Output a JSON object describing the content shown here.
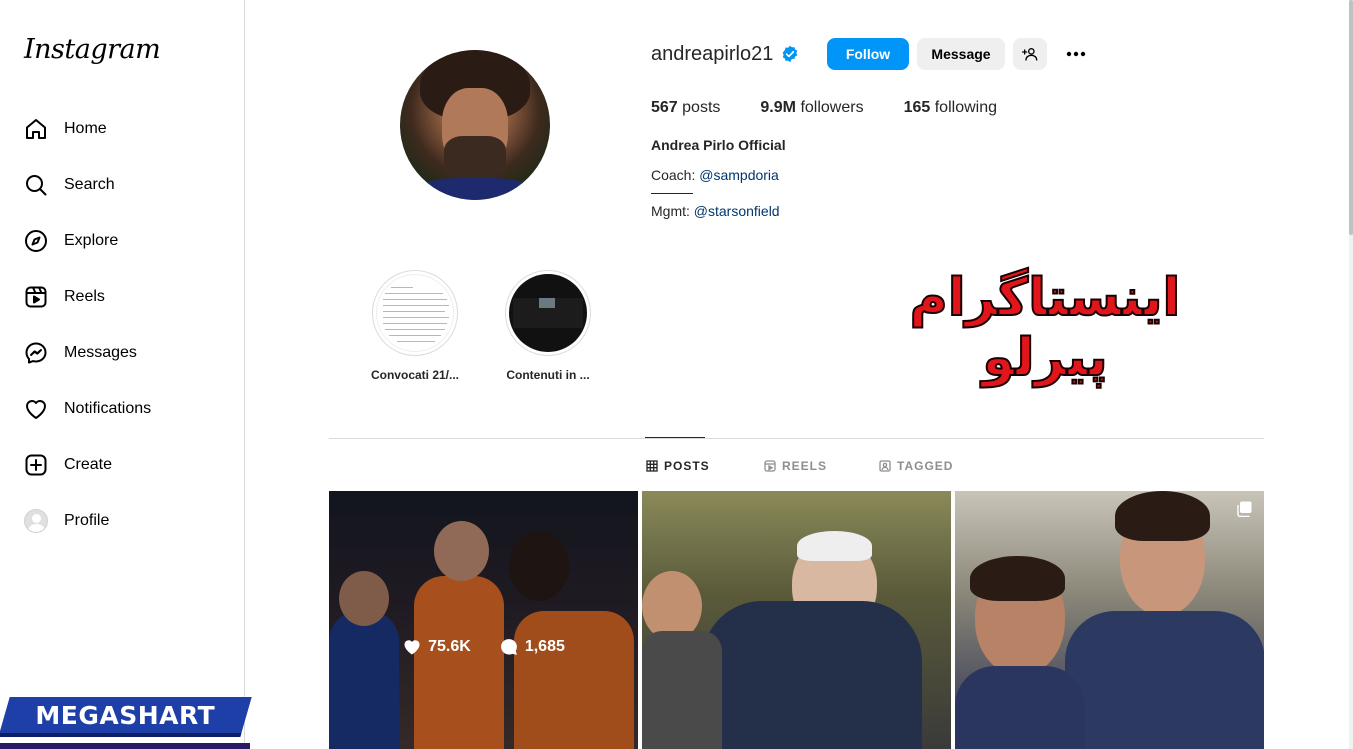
{
  "app": {
    "logo_text": "Instagram"
  },
  "sidebar": {
    "items": [
      {
        "label": "Home",
        "icon": "home-icon"
      },
      {
        "label": "Search",
        "icon": "search-icon"
      },
      {
        "label": "Explore",
        "icon": "compass-icon"
      },
      {
        "label": "Reels",
        "icon": "reels-icon"
      },
      {
        "label": "Messages",
        "icon": "messenger-icon"
      },
      {
        "label": "Notifications",
        "icon": "heart-icon"
      },
      {
        "label": "Create",
        "icon": "plus-square-icon"
      },
      {
        "label": "Profile",
        "icon": "avatar"
      }
    ]
  },
  "profile": {
    "username": "andreapirlo21",
    "verified": true,
    "follow_label": "Follow",
    "message_label": "Message",
    "stats": {
      "posts_count": "567",
      "posts_label": "posts",
      "followers_count": "9.9M",
      "followers_label": "followers",
      "following_count": "165",
      "following_label": "following"
    },
    "full_name": "Andrea Pirlo Official",
    "bio": {
      "coach_prefix": "Coach: ",
      "coach_handle": "@sampdoria",
      "mgmt_prefix": "Mgmt: ",
      "mgmt_handle": "@starsonfield"
    }
  },
  "highlights": [
    {
      "label": "Convocati 21/..."
    },
    {
      "label": "Contenuti in ..."
    }
  ],
  "overlay_text": "اینستاگرام پیرلو",
  "tabs": [
    {
      "label": "POSTS",
      "active": true
    },
    {
      "label": "REELS",
      "active": false
    },
    {
      "label": "TAGGED",
      "active": false
    }
  ],
  "posts": [
    {
      "likes": "75.6K",
      "comments": "1,685",
      "hovered": true
    },
    {
      "hovered": false
    },
    {
      "hovered": false,
      "multiple": true
    }
  ],
  "watermark": {
    "text": "MEGASHART"
  },
  "colors": {
    "follow_button": "#0095f6",
    "link": "#00376b",
    "verified": "#0095f6",
    "overlay_text": "#e0161c",
    "watermark_bg": "#1f3fa8"
  }
}
